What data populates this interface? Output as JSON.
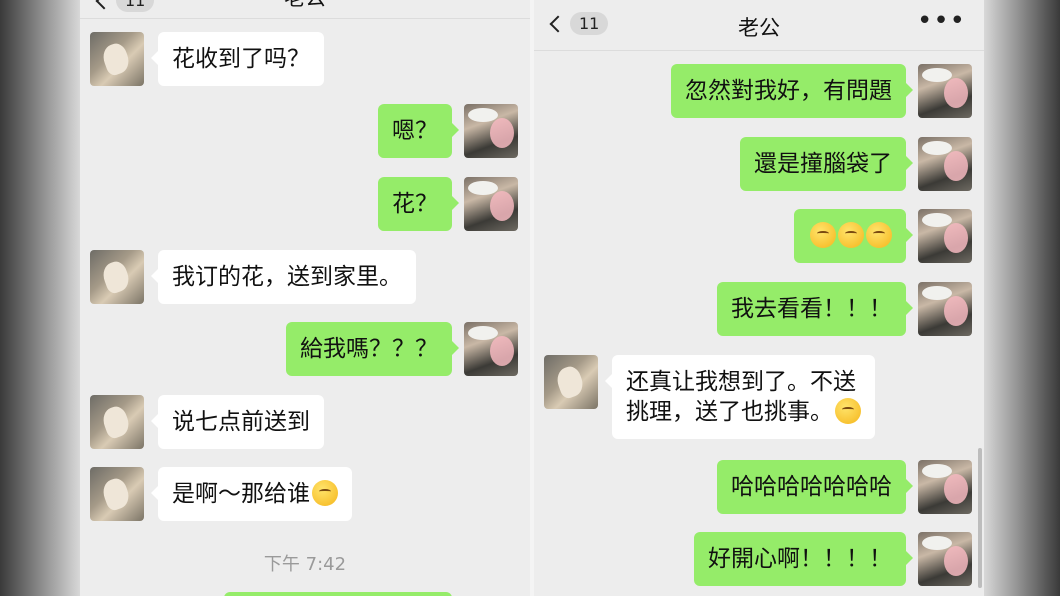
{
  "left": {
    "header": {
      "back_count": "11",
      "title": "老公",
      "more": "•••"
    },
    "messages": [
      {
        "side": "them",
        "text": "花收到了吗？"
      },
      {
        "side": "me",
        "text": "嗯？"
      },
      {
        "side": "me",
        "text": "花？"
      },
      {
        "side": "them",
        "text": "我订的花，送到家里。"
      },
      {
        "side": "me",
        "text": "給我嗎？？？"
      },
      {
        "side": "them",
        "text": "说七点前送到"
      },
      {
        "side": "them",
        "text": "是啊～那给谁"
      }
    ],
    "timestamp": "下午 7:42"
  },
  "right": {
    "header": {
      "back_count": "11",
      "title": "老公",
      "more": "•••"
    },
    "messages": [
      {
        "side": "me",
        "text": "忽然對我好，有問題"
      },
      {
        "side": "me",
        "text": "還是撞腦袋了"
      },
      {
        "side": "me",
        "text": ""
      },
      {
        "side": "me",
        "text": "我去看看！！！"
      },
      {
        "side": "them",
        "line1": "还真让我想到了。不送",
        "line2": "挑理，送了也挑事。"
      },
      {
        "side": "me",
        "text": "哈哈哈哈哈哈哈"
      },
      {
        "side": "me",
        "text": "好開心啊！！！！"
      }
    ]
  },
  "colors": {
    "sent_bubble": "#95ec69",
    "received_bubble": "#ffffff",
    "chat_bg": "#ededed"
  },
  "icons": [
    "back-chevron-icon",
    "more-dots-icon",
    "emoji-thinking-icon",
    "emoji-hmm-icon"
  ]
}
